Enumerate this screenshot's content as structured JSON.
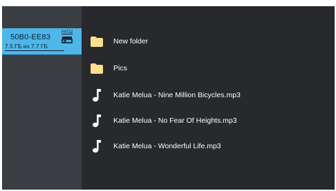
{
  "colors": {
    "sidebar_bg": "#3a3d41",
    "content_bg": "#27292c",
    "selection_bg": "#4fb6ea",
    "folder_icon": "#fde08e",
    "text": "#ffffff"
  },
  "sidebar": {
    "drive": {
      "name": "50B0-EE83",
      "size_text": "7.5 ГБ из 7.7 ГБ",
      "filesystem": "FAT32",
      "icon": "drive-icon",
      "selected": true
    }
  },
  "files": [
    {
      "name": "New folder",
      "type": "folder",
      "icon": "folder-icon"
    },
    {
      "name": "Pics",
      "type": "folder",
      "icon": "folder-icon"
    },
    {
      "name": "Katie Melua - Nine Million Bicycles.mp3",
      "type": "audio",
      "icon": "music-note-icon"
    },
    {
      "name": "Katie Melua - No Fear Of Heights.mp3",
      "type": "audio",
      "icon": "music-note-icon"
    },
    {
      "name": "Katie Melua - Wonderful Life.mp3",
      "type": "audio",
      "icon": "music-note-icon"
    }
  ]
}
